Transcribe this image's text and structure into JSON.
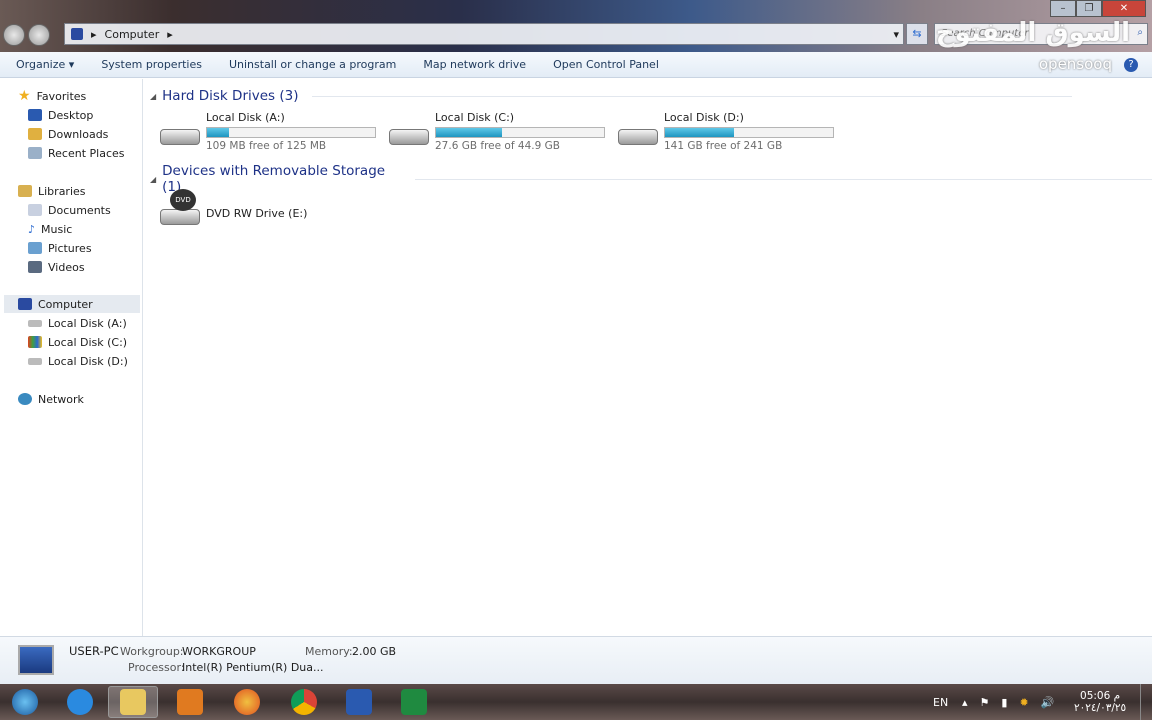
{
  "address": {
    "path": [
      "Computer"
    ],
    "search_placeholder": "Search Computer"
  },
  "toolbar": {
    "organize": "Organize",
    "items": [
      "System properties",
      "Uninstall or change a program",
      "Map network drive",
      "Open Control Panel"
    ]
  },
  "watermark": {
    "arabic": "السوق المفتوح",
    "latin": "opensooq.com"
  },
  "sidebar": {
    "favorites": {
      "label": "Favorites",
      "items": [
        "Desktop",
        "Downloads",
        "Recent Places"
      ]
    },
    "libraries": {
      "label": "Libraries",
      "items": [
        "Documents",
        "Music",
        "Pictures",
        "Videos"
      ]
    },
    "computer": {
      "label": "Computer",
      "items": [
        "Local Disk (A:)",
        "Local Disk (C:)",
        "Local Disk (D:)"
      ]
    },
    "network": {
      "label": "Network"
    }
  },
  "groups": {
    "hdd": {
      "label": "Hard Disk Drives (3)",
      "drives": [
        {
          "name": "Local Disk (A:)",
          "free": "109 MB free of 125 MB",
          "used_percent": 13
        },
        {
          "name": "Local Disk (C:)",
          "free": "27.6 GB free of 44.9 GB",
          "used_percent": 39
        },
        {
          "name": "Local Disk (D:)",
          "free": "141 GB free of 241 GB",
          "used_percent": 41
        }
      ]
    },
    "removable": {
      "label": "Devices with Removable Storage (1)",
      "drives": [
        {
          "name": "DVD RW Drive (E:)",
          "badge": "DVD"
        }
      ]
    }
  },
  "details": {
    "pc": "USER-PC",
    "workgroup_label": "Workgroup:",
    "workgroup": "WORKGROUP",
    "memory_label": "Memory:",
    "memory": "2.00 GB",
    "processor_label": "Processor:",
    "processor": "Intel(R) Pentium(R) Dua..."
  },
  "tray": {
    "lang": "EN",
    "time": "05:06 م",
    "date": "٢٠٢٤/٠٣/٢٥"
  },
  "colors": {
    "accent": "#1e3287",
    "bar": "#1e95c0"
  }
}
